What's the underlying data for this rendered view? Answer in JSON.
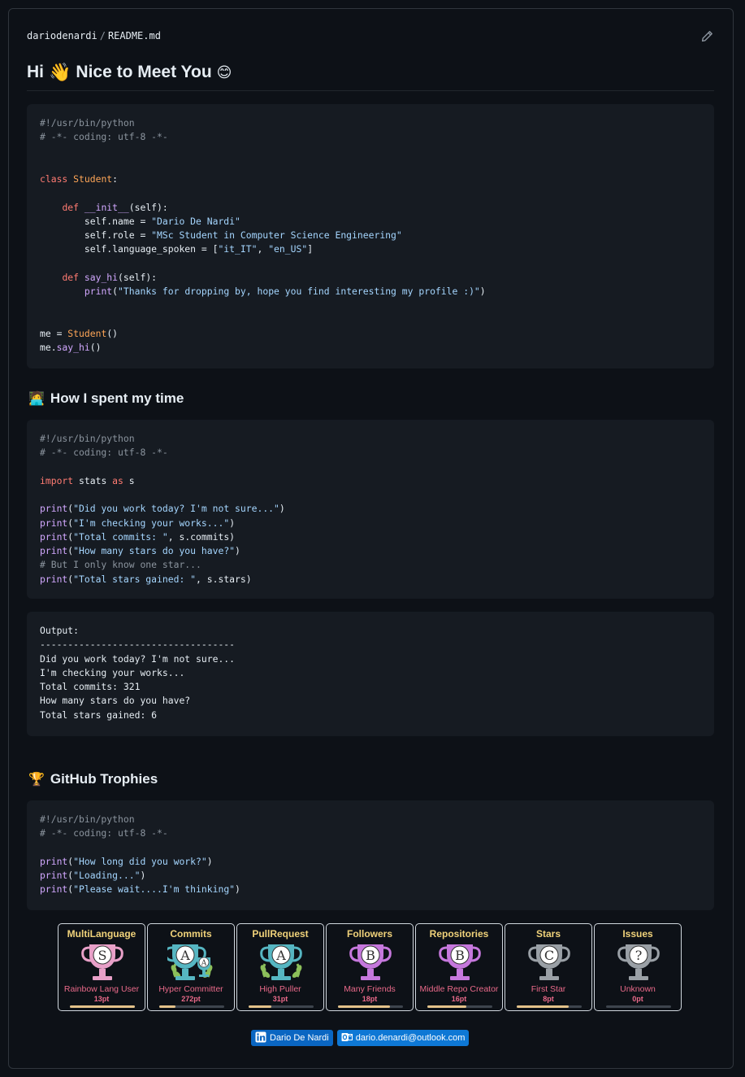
{
  "breadcrumb": {
    "owner": "dariodenardi",
    "separator": "/",
    "file": "README.md"
  },
  "heading": {
    "hi": "Hi",
    "wave_emoji": "👋",
    "text": "Nice to Meet You",
    "smile_emoji": "😊"
  },
  "code1": [
    "#!/usr/bin/python",
    "# -*- coding: utf-8 -*-",
    "",
    "",
    "class Student:",
    "",
    "    def __init__(self):",
    "        self.name = \"Dario De Nardi\"",
    "        self.role = \"MSc Student in Computer Science Engineering\"",
    "        self.language_spoken = [\"it_IT\", \"en_US\"]",
    "",
    "    def say_hi(self):",
    "        print(\"Thanks for dropping by, hope you find interesting my profile :)\")",
    "",
    "",
    "me = Student()",
    "me.say_hi()"
  ],
  "section2": {
    "emoji": "🧑‍💻",
    "title": "How I spent my time"
  },
  "code2": [
    "#!/usr/bin/python",
    "# -*- coding: utf-8 -*-",
    "",
    "import stats as s",
    "",
    "print(\"Did you work today? I'm not sure...\")",
    "print(\"I'm checking your works...\")",
    "print(\"Total commits: \", s.commits)",
    "print(\"How many stars do you have?\")",
    "# But I only know one star...",
    "print(\"Total stars gained: \", s.stars)"
  ],
  "output": [
    "Output:",
    "-----------------------------------",
    "Did you work today? I'm not sure...",
    "I'm checking your works...",
    "Total commits: 321",
    "How many stars do you have?",
    "Total stars gained: 6"
  ],
  "section3": {
    "emoji": "🏆",
    "title": "GitHub Trophies"
  },
  "code3": [
    "#!/usr/bin/python",
    "# -*- coding: utf-8 -*-",
    "",
    "print(\"How long did you work?\")",
    "print(\"Loading...\")",
    "print(\"Please wait....I'm thinking\")"
  ],
  "trophies": [
    {
      "title": "MultiLanguage",
      "rank": "S",
      "name": "Rainbow Lang User",
      "points": "13pt",
      "progress": 1.0,
      "cup_color": "#e8a0c8",
      "laurel": false
    },
    {
      "title": "Commits",
      "rank": "A",
      "name": "Hyper Committer",
      "points": "272pt",
      "progress": 0.25,
      "cup_color": "#56b6c2",
      "laurel": true,
      "sub": "A"
    },
    {
      "title": "PullRequest",
      "rank": "A",
      "name": "High Puller",
      "points": "31pt",
      "progress": 0.35,
      "cup_color": "#56b6c2",
      "laurel": true
    },
    {
      "title": "Followers",
      "rank": "B",
      "name": "Many Friends",
      "points": "18pt",
      "progress": 0.8,
      "cup_color": "#c678dd",
      "laurel": false
    },
    {
      "title": "Repositories",
      "rank": "B",
      "name": "Middle Repo Creator",
      "points": "16pt",
      "progress": 0.6,
      "cup_color": "#c678dd",
      "laurel": false
    },
    {
      "title": "Stars",
      "rank": "C",
      "name": "First Star",
      "points": "8pt",
      "progress": 0.8,
      "cup_color": "#9aa0a6",
      "laurel": false
    },
    {
      "title": "Issues",
      "rank": "?",
      "name": "Unknown",
      "points": "0pt",
      "progress": 0.0,
      "cup_color": "#9aa0a6",
      "laurel": false
    }
  ],
  "badges": {
    "linkedin": "Dario De Nardi",
    "email": "dario.denardi@outlook.com"
  }
}
